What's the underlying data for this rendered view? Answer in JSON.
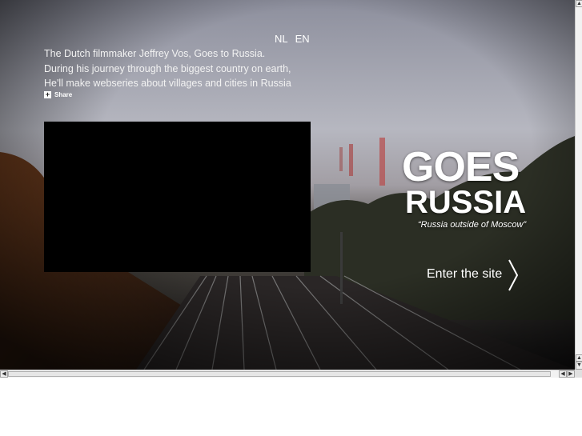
{
  "language": {
    "nl": "NL",
    "en": "EN"
  },
  "intro": {
    "lines": [
      "The Dutch filmmaker Jeffrey Vos, Goes to Russia.",
      "During his journey through the biggest country on earth,",
      "He'll make webseries about villages and cities in Russia"
    ]
  },
  "share": {
    "label": "Share",
    "icon": "plus-icon"
  },
  "logo": {
    "line1": "GOES",
    "line2": "RUSSIA",
    "tagline": "“Russia outside of Moscow”"
  },
  "enter": {
    "label": "Enter the site",
    "icon": "chevron-right-icon"
  },
  "scrollbars": {
    "up": "▲",
    "down": "▼",
    "left": "◀",
    "right": "▶"
  },
  "colors": {
    "text": "#ffffff",
    "video": "#000000",
    "page_background": "#ffffff"
  }
}
